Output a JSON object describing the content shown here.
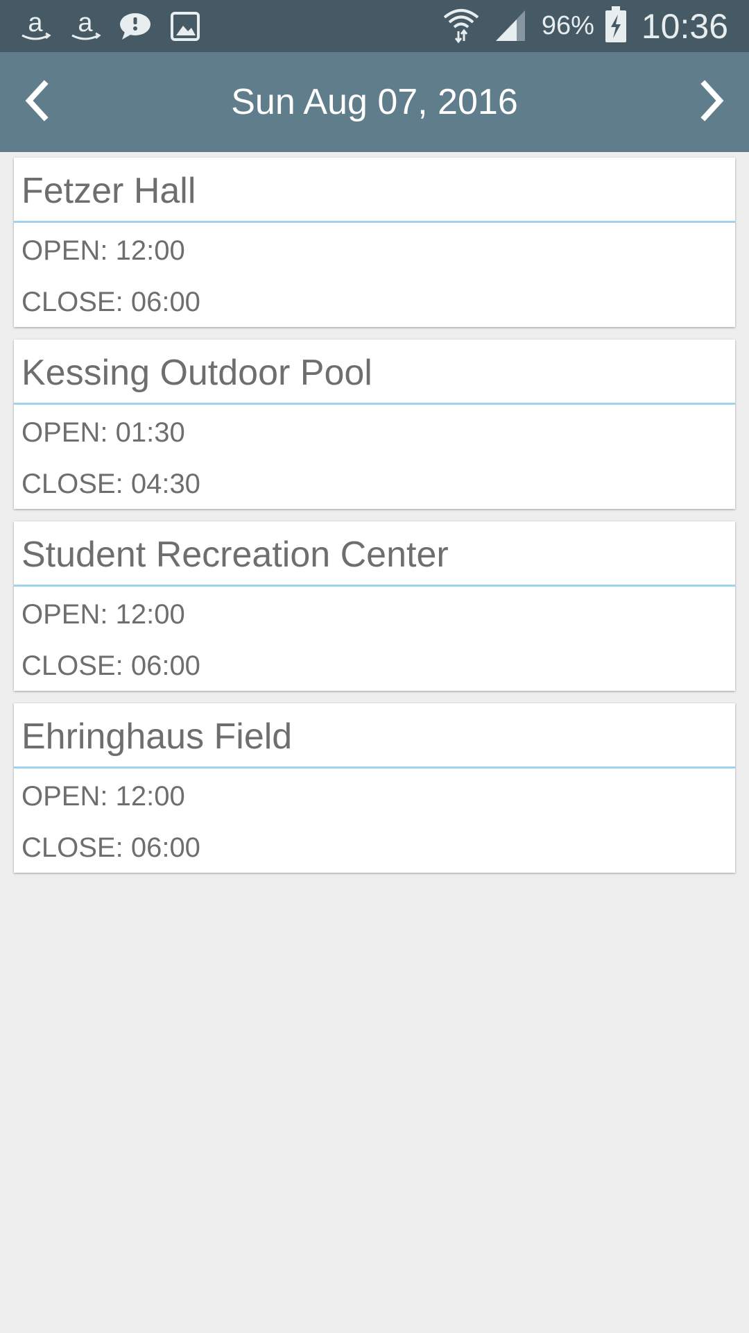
{
  "status_bar": {
    "icons_left": [
      "amazon-icon",
      "amazon-icon",
      "chat-icon",
      "image-icon"
    ],
    "icons_right": [
      "wifi-icon",
      "signal-icon",
      "battery-icon"
    ],
    "battery": "96%",
    "time": "10:36"
  },
  "header": {
    "date": "Sun Aug 07, 2016",
    "prev_icon": "chevron-left-icon",
    "next_icon": "chevron-right-icon",
    "color": "#607d8b"
  },
  "facilities": [
    {
      "name": "Fetzer Hall",
      "open": "OPEN: 12:00",
      "close": "CLOSE: 06:00"
    },
    {
      "name": "Kessing Outdoor Pool",
      "open": "OPEN: 01:30",
      "close": "CLOSE: 04:30"
    },
    {
      "name": "Student Recreation Center",
      "open": "OPEN: 12:00",
      "close": "CLOSE: 06:00"
    },
    {
      "name": "Ehringhaus Field",
      "open": "OPEN: 12:00",
      "close": "CLOSE: 06:00"
    }
  ],
  "colors": {
    "status_bar": "#455a64",
    "divider": "#9ed2ef",
    "background": "#eeeeee",
    "text": "#6e6e6e"
  }
}
